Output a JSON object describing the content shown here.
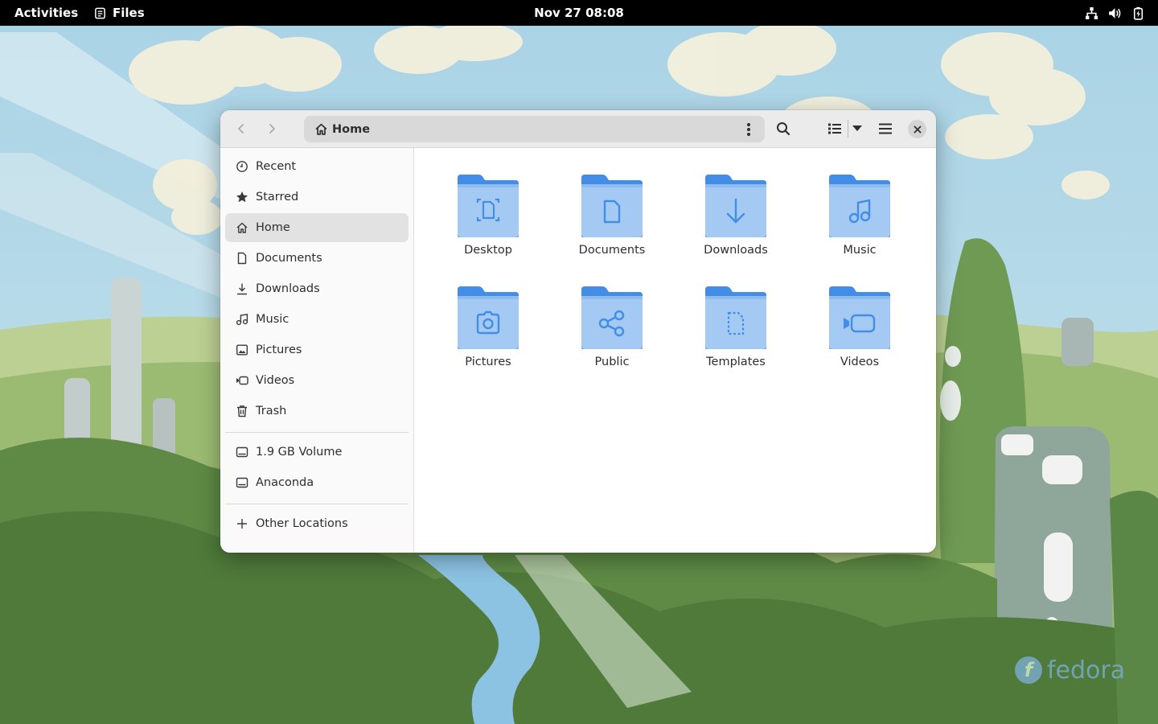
{
  "topbar": {
    "activities": "Activities",
    "app_name": "Files",
    "app_icon": "files-app-icon",
    "clock": "Nov 27  08:08",
    "status_icons": [
      "network-wired-icon",
      "volume-icon",
      "battery-icon"
    ]
  },
  "window": {
    "path": {
      "label": "Home",
      "icon": "home-icon"
    },
    "toolbar_icons": [
      "back-arrow-icon",
      "forward-arrow-icon",
      "search-icon",
      "list-view-icon",
      "chevron-down-icon",
      "hamburger-menu-icon",
      "close-icon"
    ]
  },
  "sidebar": {
    "items": [
      {
        "label": "Recent",
        "icon": "clock-icon"
      },
      {
        "label": "Starred",
        "icon": "star-icon"
      },
      {
        "label": "Home",
        "icon": "home-icon",
        "active": true
      },
      {
        "label": "Documents",
        "icon": "document-icon"
      },
      {
        "label": "Downloads",
        "icon": "download-icon"
      },
      {
        "label": "Music",
        "icon": "music-icon"
      },
      {
        "label": "Pictures",
        "icon": "image-icon"
      },
      {
        "label": "Videos",
        "icon": "video-camera-icon"
      },
      {
        "label": "Trash",
        "icon": "trash-icon"
      }
    ],
    "volumes": [
      {
        "label": "1.9 GB Volume",
        "icon": "drive-icon"
      },
      {
        "label": "Anaconda",
        "icon": "drive-icon"
      }
    ],
    "other": {
      "label": "Other Locations",
      "icon": "plus-icon"
    }
  },
  "folders": [
    {
      "label": "Desktop",
      "icon": "desktop-folder-icon"
    },
    {
      "label": "Documents",
      "icon": "documents-folder-icon"
    },
    {
      "label": "Downloads",
      "icon": "downloads-folder-icon"
    },
    {
      "label": "Music",
      "icon": "music-folder-icon"
    },
    {
      "label": "Pictures",
      "icon": "pictures-folder-icon"
    },
    {
      "label": "Public",
      "icon": "public-folder-icon"
    },
    {
      "label": "Templates",
      "icon": "templates-folder-icon"
    },
    {
      "label": "Videos",
      "icon": "videos-folder-icon"
    }
  ],
  "desktop": {
    "logo_text": "fedora",
    "logo_mark": "f"
  },
  "colors": {
    "folder_blue": "#438de6",
    "folder_light": "#a4caf3",
    "accent": "#3584e4"
  }
}
